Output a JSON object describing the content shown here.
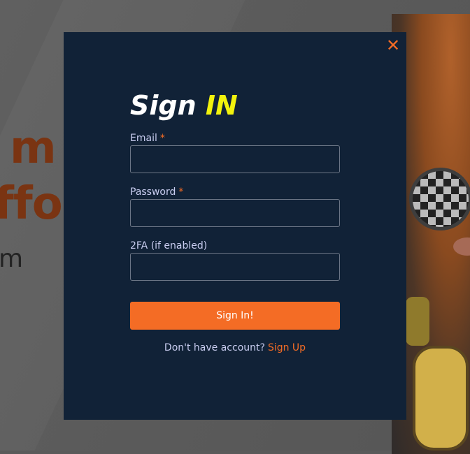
{
  "background": {
    "headline_line1": "m",
    "headline_line2": "ffor",
    "subtext": "m"
  },
  "modal": {
    "close_icon": "close-icon",
    "title_main": "Sign",
    "title_accent": "IN",
    "fields": {
      "email": {
        "label": "Email",
        "required_mark": "*",
        "value": "",
        "placeholder": ""
      },
      "password": {
        "label": "Password",
        "required_mark": "*",
        "value": "",
        "placeholder": ""
      },
      "twofa": {
        "label": "2FA (if enabled)",
        "value": "",
        "placeholder": ""
      }
    },
    "submit_label": "Sign In!",
    "signup_prompt": "Don't have account?",
    "signup_link": "Sign Up"
  },
  "colors": {
    "modal_bg": "#112237",
    "accent_orange": "#f46c25",
    "title_yellow": "#f2f20d",
    "label_text": "#c9cdf0",
    "overlay": "#5a5a5a"
  }
}
